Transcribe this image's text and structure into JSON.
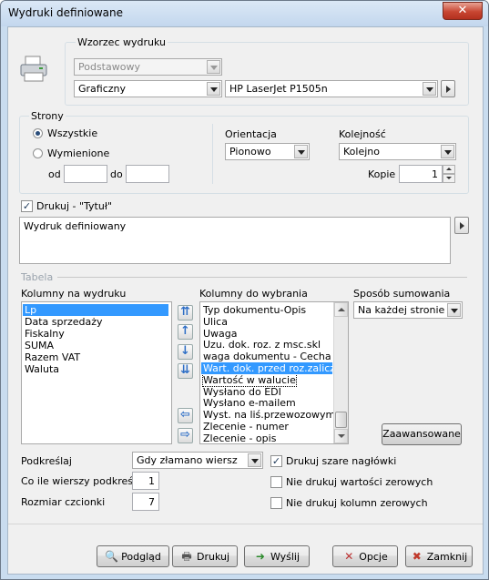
{
  "window": {
    "title": "Wydruki definiowane",
    "close_glyph": "✕"
  },
  "pattern": {
    "legend": "Wzorzec  wydruku",
    "template_value": "Podstawowy",
    "mode_value": "Graficzny",
    "printer_value": "HP LaserJet P1505n"
  },
  "pages": {
    "legend": "Strony",
    "all_label": "Wszystkie",
    "selected_label": "Wymienione",
    "from_label": "od",
    "to_label": "do",
    "from_value": "",
    "to_value": "",
    "orientation_label": "Orientacja",
    "orientation_value": "Pionowo",
    "order_label": "Kolejność",
    "order_value": "Kolejno",
    "copies_label": "Kopie",
    "copies_value": "1"
  },
  "title_section": {
    "checkbox_label": "Drukuj - \"Tytuł\"",
    "text_value": "Wydruk definiowany"
  },
  "table": {
    "legend": "Tabela",
    "columns_print_label": "Kolumny na wydruku",
    "columns_print": [
      "Lp",
      "Data sprzedaży",
      "Fiskalny",
      "SUMA",
      "Razem VAT",
      "Waluta"
    ],
    "columns_available_label": "Kolumny do wybrania",
    "columns_available": [
      "Typ dokumentu-Opis",
      "Ulica",
      "Uwaga",
      "Uzu. dok. roz. z msc.skl",
      "waga dokumentu - Cecha",
      "Wart. dok. przed roz.zaliczką",
      "Wartość w walucie",
      "Wysłano do EDI",
      "Wysłano e-mailem",
      "Wyst. na liś.przewozowym",
      "Zlecenie - numer",
      "Zlecenie - opis"
    ],
    "summing_label": "Sposób sumowania",
    "summing_value": "Na każdej stronie",
    "advanced_button": "Zaawansowane"
  },
  "options": {
    "underline_label": "Podkreślaj",
    "underline_value": "Gdy złamano wiersz",
    "every_rows_label": "Co ile wierszy podkreślać",
    "every_rows_value": "1",
    "font_size_label": "Rozmiar czcionki",
    "font_size_value": "7",
    "gray_headers_label": "Drukuj szare nagłówki",
    "no_zero_values_label": "Nie drukuj wartości zerowych",
    "no_zero_columns_label": "Nie drukuj kolumn zerowych"
  },
  "buttons": {
    "preview": "Podgląd",
    "print": "Drukuj",
    "send": "Wyślij",
    "options": "Opcje",
    "close": "Zamknij"
  },
  "icons": {
    "check_mark": "✓",
    "move_top": "⇈",
    "move_up": "↑",
    "move_down": "↓",
    "move_bottom": "⇊",
    "move_left": "⇦",
    "move_right": "⇨",
    "preview_icon": "🔍",
    "print_icon": "🖶",
    "send_icon": "➜",
    "options_icon": "✕",
    "close_icon": "✖"
  },
  "colors": {
    "selection": "#3399ff",
    "close_red": "#c84632"
  }
}
